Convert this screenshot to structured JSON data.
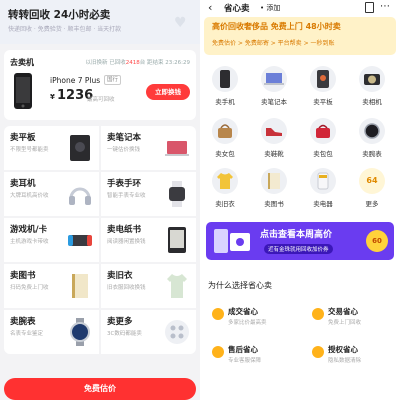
{
  "left": {
    "header": {
      "title": "转转回收 24小时必卖",
      "subtitle": "快递回收 · 免费验货 · 顺丰包邮 · 当天打款"
    },
    "sell": {
      "label": "去卖机",
      "time_prefix": "以旧换新 已回收",
      "time_count": "2418",
      "time_suffix": "台 距结束 23:26:29",
      "phone_name": "iPhone 7 Plus",
      "phone_tag": "国行",
      "price_symbol": "¥",
      "price": "1236",
      "price_note": "最高可回收",
      "redeem_button": "立即换钱"
    },
    "categories": [
      {
        "title": "卖平板",
        "desc": "不限型号都能卖"
      },
      {
        "title": "卖笔记本",
        "desc": "一键估价换钱"
      },
      {
        "title": "卖耳机",
        "desc": "大牌耳机高价收"
      },
      {
        "title": "手表手环",
        "desc": "智能手表专业收"
      },
      {
        "title": "游戏机/卡",
        "desc": "主机游戏卡带收"
      },
      {
        "title": "卖电纸书",
        "desc": "阅读器闲置换钱"
      },
      {
        "title": "卖图书",
        "desc": "扫码免费上门收"
      },
      {
        "title": "卖旧衣",
        "desc": "旧衣服回收换钱"
      },
      {
        "title": "卖腕表",
        "desc": "名表专业鉴定"
      },
      {
        "title": "卖更多",
        "desc": "3C数码都能卖"
      }
    ],
    "cta": "免费估价"
  },
  "right": {
    "nav": {
      "back": "‹",
      "title": "省心卖",
      "add": "• 添加"
    },
    "banner": {
      "line1": "高价回收奢侈品 免费上门 48小时卖",
      "line2": "免费估价 > 免费邮寄 > 平台帮卖 > 一秒到账"
    },
    "grid": [
      {
        "label": "卖手机",
        "icon": "phone-icon"
      },
      {
        "label": "卖笔记本",
        "icon": "laptop-icon"
      },
      {
        "label": "卖平板",
        "icon": "tablet-icon"
      },
      {
        "label": "卖相机",
        "icon": "camera-icon"
      },
      {
        "label": "卖女包",
        "icon": "handbag-icon"
      },
      {
        "label": "卖鞋靴",
        "icon": "shoe-icon"
      },
      {
        "label": "卖包包",
        "icon": "bag-icon"
      },
      {
        "label": "卖腕表",
        "icon": "watch-icon"
      },
      {
        "label": "卖旧衣",
        "icon": "shirt-icon"
      },
      {
        "label": "卖图书",
        "icon": "book-icon"
      },
      {
        "label": "卖电器",
        "icon": "appliance-icon"
      },
      {
        "label": "更多",
        "icon": "more-icon"
      }
    ],
    "more_badge": "64",
    "promo": {
      "main": "点击查看本周高价",
      "sub": "近有金珠就用回收加价券",
      "badge": "60"
    },
    "why_title": "为什么选择省心卖",
    "features": [
      {
        "title": "成交省心",
        "desc": "多家比价最高卖"
      },
      {
        "title": "交易省心",
        "desc": "免费上门回收"
      },
      {
        "title": "售后省心",
        "desc": "专业客服保障"
      },
      {
        "title": "授权省心",
        "desc": "隐私数据清除"
      }
    ],
    "colors": {
      "accent_red": "#ff3131",
      "banner_orange": "#d97a00",
      "promo_purple": "#6a3cf0"
    }
  }
}
